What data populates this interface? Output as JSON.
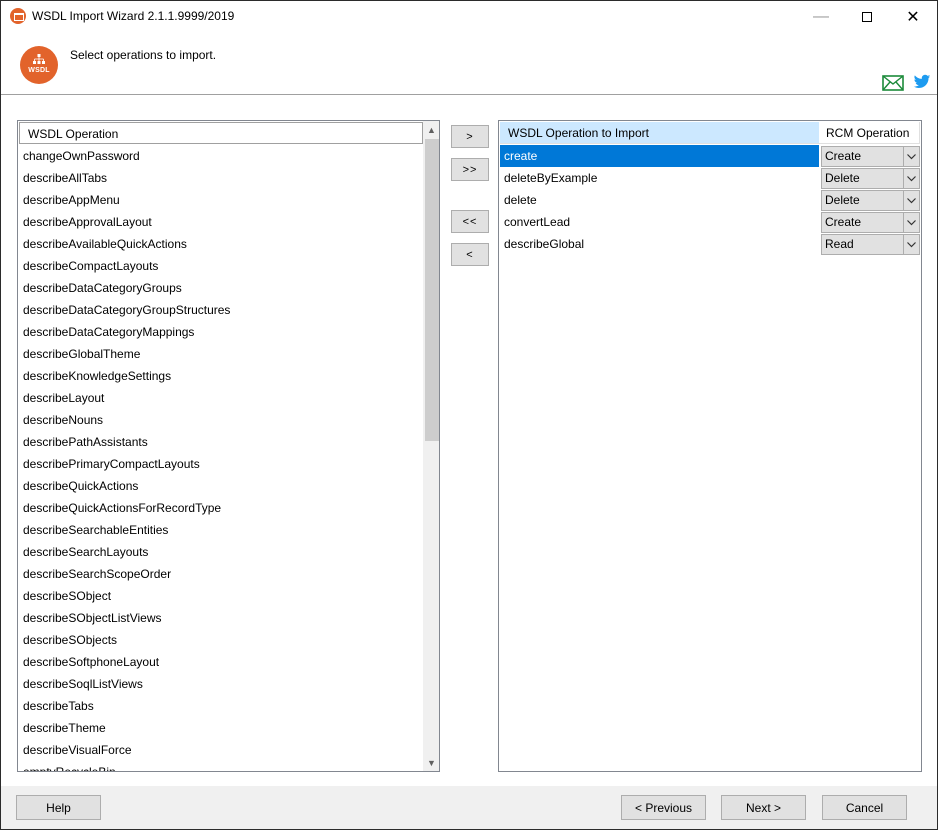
{
  "window": {
    "title": "WSDL Import Wizard 2.1.1.9999/2019"
  },
  "header": {
    "instruction": "Select operations to import.",
    "logo_text": "WSDL"
  },
  "left_list": {
    "column_header": "WSDL Operation",
    "items": [
      "changeOwnPassword",
      "describeAllTabs",
      "describeAppMenu",
      "describeApprovalLayout",
      "describeAvailableQuickActions",
      "describeCompactLayouts",
      "describeDataCategoryGroups",
      "describeDataCategoryGroupStructures",
      "describeDataCategoryMappings",
      "describeGlobalTheme",
      "describeKnowledgeSettings",
      "describeLayout",
      "describeNouns",
      "describePathAssistants",
      "describePrimaryCompactLayouts",
      "describeQuickActions",
      "describeQuickActionsForRecordType",
      "describeSearchableEntities",
      "describeSearchLayouts",
      "describeSearchScopeOrder",
      "describeSObject",
      "describeSObjectListViews",
      "describeSObjects",
      "describeSoftphoneLayout",
      "describeSoqlListViews",
      "describeTabs",
      "describeTheme",
      "describeVisualForce",
      "emptyRecycleBin"
    ]
  },
  "mid_buttons": {
    "add": ">",
    "add_all": ">>",
    "remove_all": "<<",
    "remove": "<"
  },
  "right_list": {
    "column_op": "WSDL Operation to Import",
    "column_rcm": "RCM Operation",
    "rows": [
      {
        "op": "create",
        "rcm": "Create",
        "selected": true
      },
      {
        "op": "deleteByExample",
        "rcm": "Delete",
        "selected": false
      },
      {
        "op": "delete",
        "rcm": "Delete",
        "selected": false
      },
      {
        "op": "convertLead",
        "rcm": "Create",
        "selected": false
      },
      {
        "op": "describeGlobal",
        "rcm": "Read",
        "selected": false
      }
    ]
  },
  "footer": {
    "help": "Help",
    "previous": "< Previous",
    "next": "Next >",
    "cancel": "Cancel"
  },
  "colors": {
    "accent": "#e2632b",
    "selection": "#0078d7",
    "header_highlight": "#cce8ff"
  }
}
